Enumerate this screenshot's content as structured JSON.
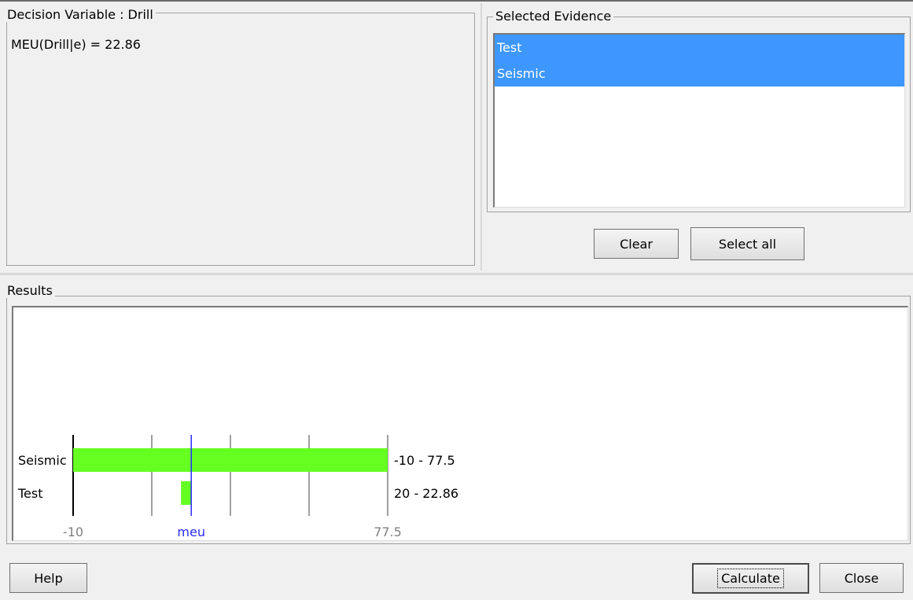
{
  "decision_panel": {
    "legend": "Decision Variable : Drill",
    "meu_text": "MEU(Drill|e) = 22.86"
  },
  "evidence_panel": {
    "legend": "Selected Evidence",
    "items": [
      {
        "label": "Test",
        "selected": true
      },
      {
        "label": "Seismic",
        "selected": true
      }
    ],
    "clear_label": "Clear",
    "select_all_label": "Select all"
  },
  "results_panel": {
    "legend": "Results"
  },
  "chart_data": {
    "type": "bar",
    "orientation": "horizontal",
    "categories": [
      "Seismic",
      "Test"
    ],
    "ranges": [
      [
        -10,
        77.5
      ],
      [
        20,
        22.86
      ]
    ],
    "range_labels": [
      "-10 - 77.5",
      "20 - 22.86"
    ],
    "xlim": [
      -10,
      77.5
    ],
    "x_tick_labels": [
      "-10",
      "77.5"
    ],
    "meu": 22.86,
    "meu_label": "meu",
    "bar_color": "#66ff22",
    "meu_color": "#2a2aff"
  },
  "footer": {
    "help_label": "Help",
    "calculate_label": "Calculate",
    "close_label": "Close"
  }
}
